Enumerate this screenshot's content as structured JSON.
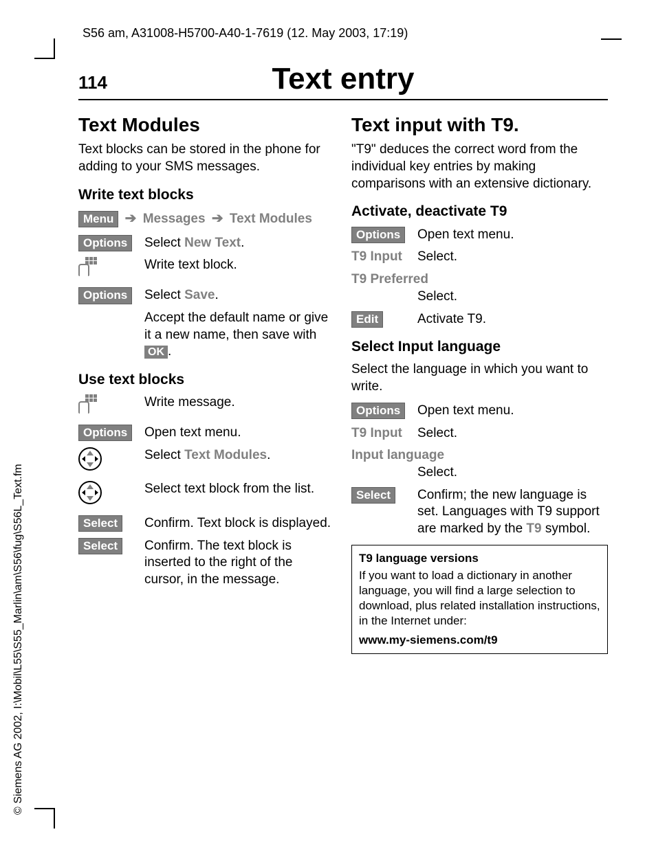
{
  "meta": {
    "header": "S56 am, A31008-H5700-A40-1-7619 (12. May 2003, 17:19)"
  },
  "copyright": "© Siemens AG 2002, I:\\Mobil\\L55\\S55_Marlin\\am\\S56\\fug\\S56L_Text.fm",
  "page": {
    "number": "114",
    "title": "Text entry"
  },
  "softkeys": {
    "menu": "Menu",
    "options": "Options",
    "ok": "OK",
    "select": "Select",
    "edit": "Edit"
  },
  "nav": {
    "messages": "Messages",
    "text_modules": "Text Modules"
  },
  "left": {
    "h2": "Text Modules",
    "intro": "Text blocks can be stored in the phone for adding to your SMS messages.",
    "h3a": "Write text blocks",
    "step1_pre": "Select ",
    "step1_bold": "New Text",
    "step1_post": ".",
    "step2": "Write text block.",
    "step3_pre": "Select ",
    "step3_bold": "Save",
    "step3_post": ".",
    "step4a": "Accept the default name or give it a new name, then save with ",
    "step4b": ".",
    "h3b": "Use text blocks",
    "u1": "Write message.",
    "u2": "Open text menu.",
    "u3_pre": "Select ",
    "u3_bold": "Text Modules",
    "u3_post": ".",
    "u4": "Select text block from the list.",
    "u5": "Confirm. Text block is displayed.",
    "u6": "Confirm. The text block is inserted to the right of the cursor, in the message."
  },
  "right": {
    "h2": "Text input with T9.",
    "intro": "\"T9\" deduces the correct word from the individual key entries by making comparisons with an extensive dictionary.",
    "h3a": "Activate, deactivate T9",
    "a1": "Open text menu.",
    "a2_key": "T9 Input",
    "a2": "Select.",
    "a3_key": "T9 Preferred",
    "a3": "Select.",
    "a4": "Activate T9.",
    "h3b": "Select Input language",
    "sel_intro": "Select the language in which you want to write.",
    "s1": "Open text menu.",
    "s2_key": "T9 Input",
    "s2": "Select.",
    "s3_key": "Input language",
    "s3": "Select.",
    "s4a": "Confirm; the new language is set. Languages with T9 support are marked by the ",
    "s4b": "T9",
    "s4c": " symbol.",
    "box_title": "T9 language versions",
    "box_body": "If you want to load a dictionary in another language, you will find a large selection to download, plus related installation instructions, in the Internet under:",
    "box_url": "www.my-siemens.com/t9"
  }
}
